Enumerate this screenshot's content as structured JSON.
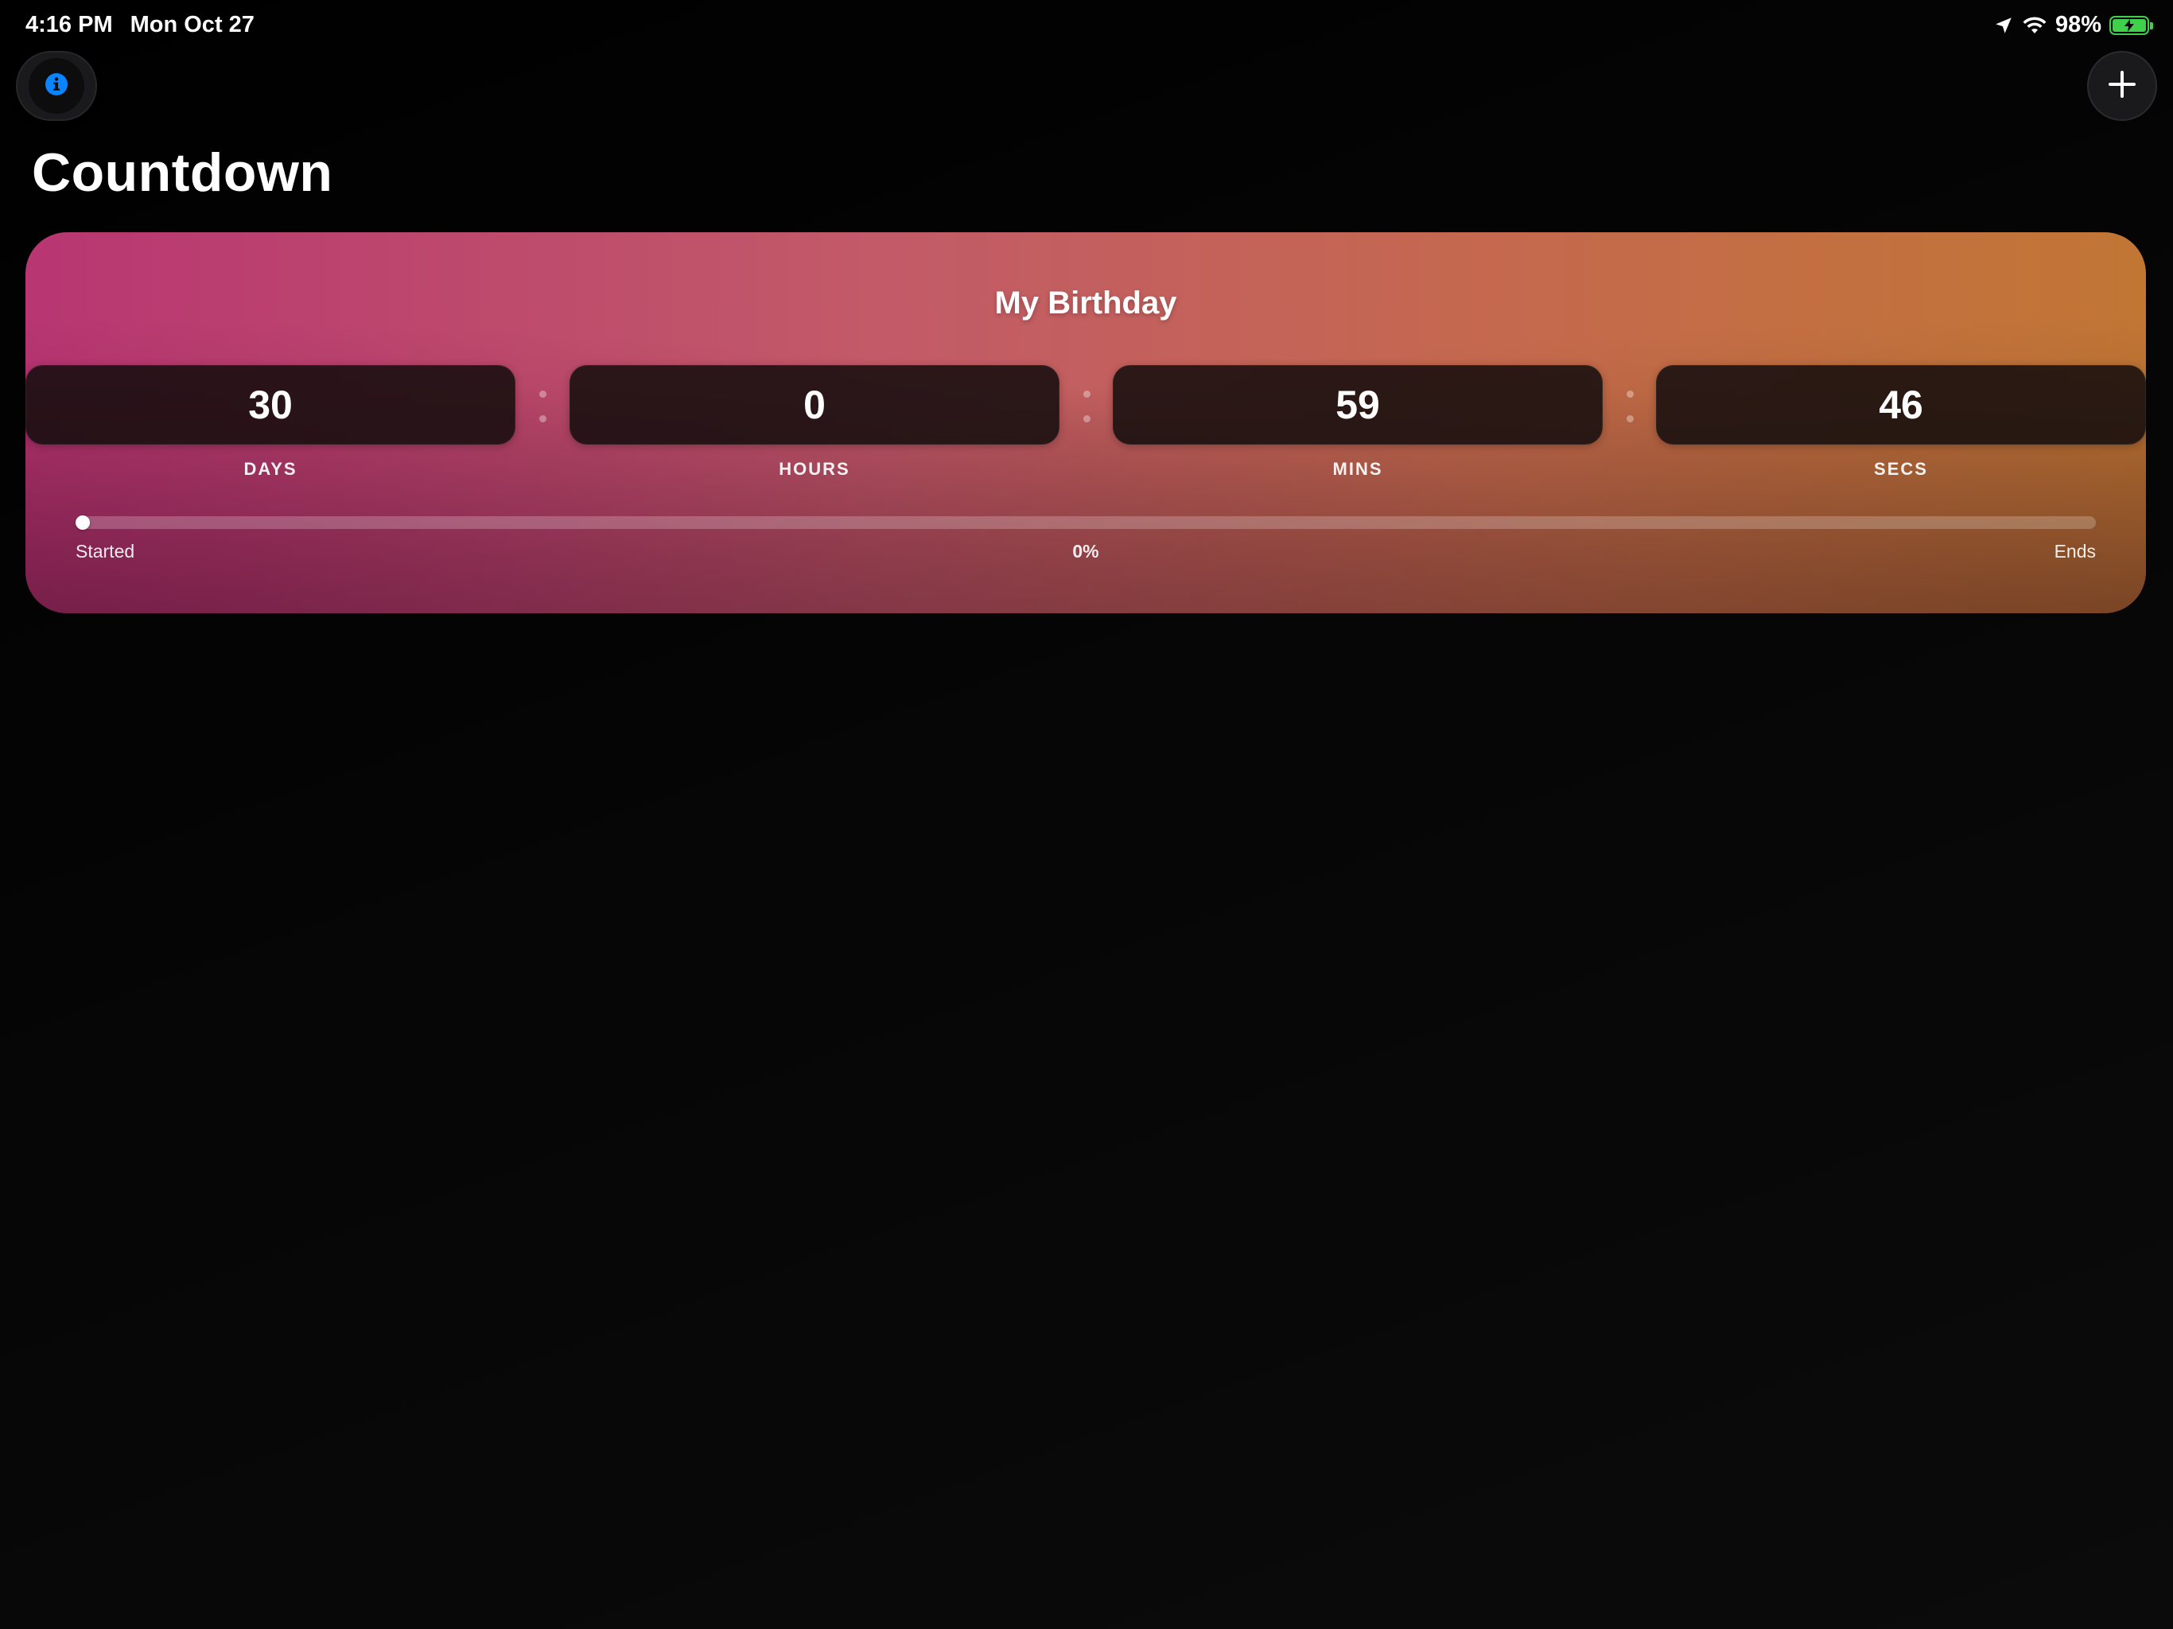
{
  "status_bar": {
    "time": "4:16 PM",
    "date": "Mon Oct 27",
    "battery": "98%",
    "icons": [
      "location-arrow-icon",
      "wifi-icon",
      "battery-charging-icon"
    ],
    "battery_color": "#3fd14b"
  },
  "toolbar": {
    "info_icon": "info-icon",
    "info_color": "#0a84ff",
    "add_icon": "plus-icon"
  },
  "page": {
    "title": "Countdown"
  },
  "countdown": {
    "title": "My Birthday",
    "gradient": [
      "#b83672",
      "#c17634"
    ],
    "units": [
      {
        "value": "30",
        "label": "DAYS"
      },
      {
        "value": "0",
        "label": "HOURS"
      },
      {
        "value": "59",
        "label": "MINS"
      },
      {
        "value": "46",
        "label": "SECS"
      }
    ],
    "progress": {
      "fraction": 0,
      "start_label": "Started",
      "percent_label": "0%",
      "end_label": "Ends"
    }
  }
}
